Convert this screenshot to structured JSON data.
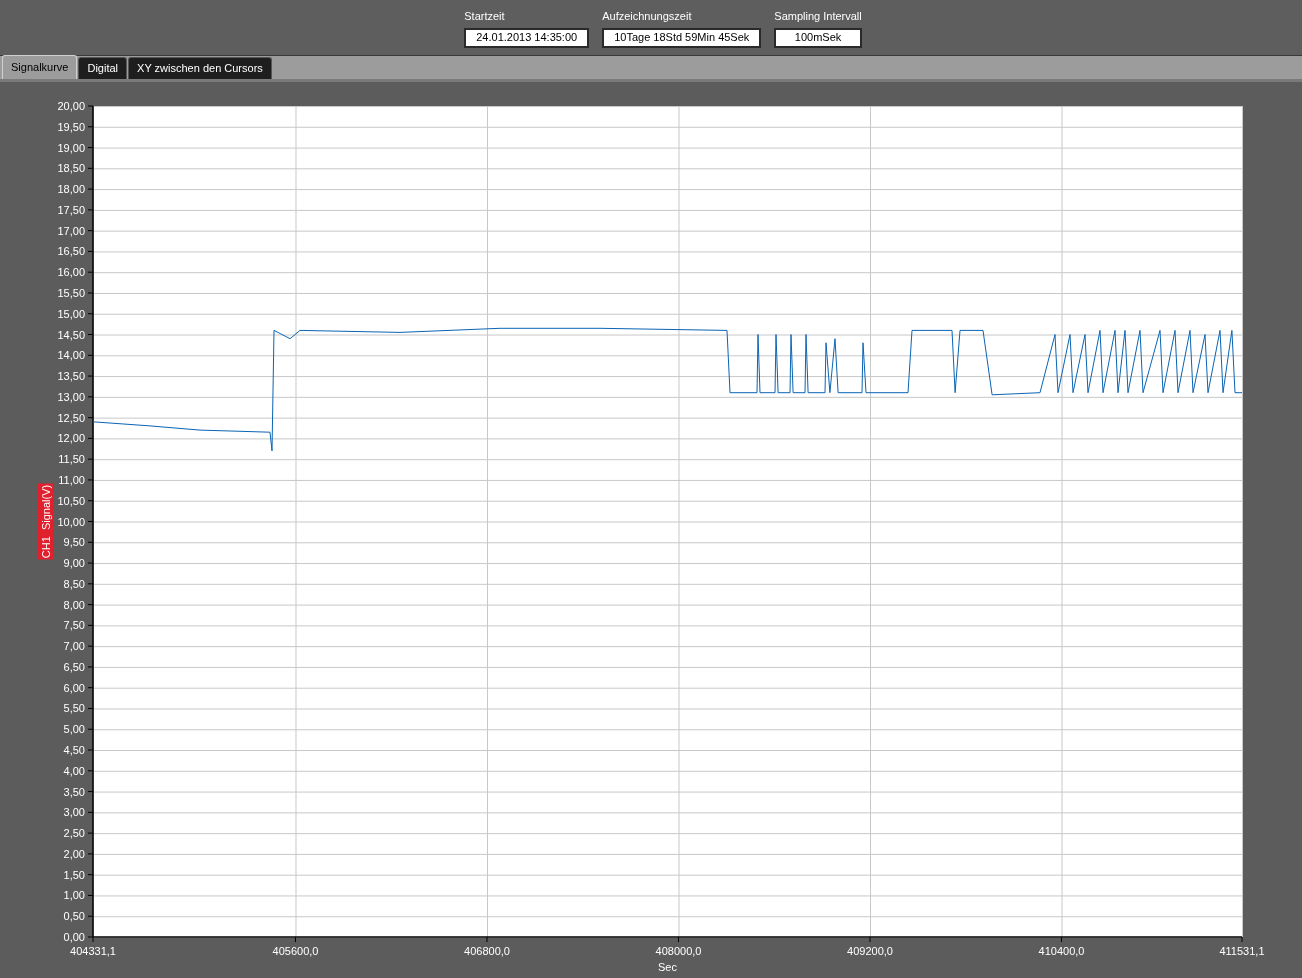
{
  "header_fields": [
    {
      "label": "Startzeit",
      "value": "24.01.2013 14:35:00"
    },
    {
      "label": "Aufzeichnungszeit",
      "value": "10Tage 18Std 59Min 45Sek"
    },
    {
      "label": "Sampling Intervall",
      "value": "100mSek"
    }
  ],
  "tabs": [
    {
      "label": "Signalkurve",
      "selected": true
    },
    {
      "label": "Digital",
      "selected": false
    },
    {
      "label": "XY zwischen den Cursors",
      "selected": false
    }
  ],
  "chart": {
    "chart_data": {
      "type": "line",
      "xlabel": "Sec",
      "ylabel": "CH1  Signal(V)",
      "xlim": [
        404331.1,
        411531.1
      ],
      "ylim": [
        0,
        20
      ],
      "xticks": [
        {
          "value": 404331.1,
          "label": "404331,1"
        },
        {
          "value": 405600,
          "label": "405600,0"
        },
        {
          "value": 406800,
          "label": "406800,0"
        },
        {
          "value": 408000,
          "label": "408000,0"
        },
        {
          "value": 409200,
          "label": "409200,0"
        },
        {
          "value": 410400,
          "label": "410400,0"
        },
        {
          "value": 411531.1,
          "label": "411531,1"
        }
      ],
      "yticks": [
        {
          "value": 0,
          "label": "0,00"
        },
        {
          "value": 0.5,
          "label": "0,50"
        },
        {
          "value": 1,
          "label": "1,00"
        },
        {
          "value": 1.5,
          "label": "1,50"
        },
        {
          "value": 2,
          "label": "2,00"
        },
        {
          "value": 2.5,
          "label": "2,50"
        },
        {
          "value": 3,
          "label": "3,00"
        },
        {
          "value": 3.5,
          "label": "3,50"
        },
        {
          "value": 4,
          "label": "4,00"
        },
        {
          "value": 4.5,
          "label": "4,50"
        },
        {
          "value": 5,
          "label": "5,00"
        },
        {
          "value": 5.5,
          "label": "5,50"
        },
        {
          "value": 6,
          "label": "6,00"
        },
        {
          "value": 6.5,
          "label": "6,50"
        },
        {
          "value": 7,
          "label": "7,00"
        },
        {
          "value": 7.5,
          "label": "7,50"
        },
        {
          "value": 8,
          "label": "8,00"
        },
        {
          "value": 8.5,
          "label": "8,50"
        },
        {
          "value": 9,
          "label": "9,00"
        },
        {
          "value": 9.5,
          "label": "9,50"
        },
        {
          "value": 10,
          "label": "10,00"
        },
        {
          "value": 10.5,
          "label": "10,50"
        },
        {
          "value": 11,
          "label": "11,00"
        },
        {
          "value": 11.5,
          "label": "11,50"
        },
        {
          "value": 12,
          "label": "12,00"
        },
        {
          "value": 12.5,
          "label": "12,50"
        },
        {
          "value": 13,
          "label": "13,00"
        },
        {
          "value": 13.5,
          "label": "13,50"
        },
        {
          "value": 14,
          "label": "14,00"
        },
        {
          "value": 14.5,
          "label": "14,50"
        },
        {
          "value": 15,
          "label": "15,00"
        },
        {
          "value": 15.5,
          "label": "15,50"
        },
        {
          "value": 16,
          "label": "16,00"
        },
        {
          "value": 16.5,
          "label": "16,50"
        },
        {
          "value": 17,
          "label": "17,00"
        },
        {
          "value": 17.5,
          "label": "17,50"
        },
        {
          "value": 18,
          "label": "18,00"
        },
        {
          "value": 18.5,
          "label": "18,50"
        },
        {
          "value": 19,
          "label": "19,00"
        },
        {
          "value": 19.5,
          "label": "19,50"
        },
        {
          "value": 20,
          "label": "20,00"
        }
      ],
      "grid": true,
      "x": [
        404331.1,
        404688,
        405002,
        405440,
        405453,
        405465,
        405566,
        405628,
        406255,
        406882,
        407508,
        408304,
        408323,
        408492,
        408498,
        408511,
        408605,
        408611,
        408624,
        408699,
        408705,
        408718,
        408793,
        408799,
        408812,
        408918,
        408924,
        408949,
        408981,
        409000,
        409150,
        409156,
        409175,
        409438,
        409463,
        409714,
        409733,
        409764,
        409908,
        409965,
        410265,
        410359,
        410378,
        410453,
        410472,
        410547,
        410566,
        410641,
        410660,
        410735,
        410754,
        410798,
        410817,
        410892,
        410911,
        411017,
        411036,
        411111,
        411130,
        411205,
        411224,
        411299,
        411318,
        411393,
        411412,
        411468,
        411487,
        411531
      ],
      "series": [
        {
          "color": "#0a64b4",
          "values": [
            12.4,
            12.3,
            12.2,
            12.15,
            11.7,
            14.6,
            14.4,
            14.6,
            14.55,
            14.65,
            14.65,
            14.6,
            13.1,
            13.1,
            14.5,
            13.1,
            13.1,
            14.5,
            13.1,
            13.1,
            14.5,
            13.1,
            13.1,
            14.5,
            13.1,
            13.1,
            14.3,
            13.1,
            14.4,
            13.1,
            13.1,
            14.3,
            13.1,
            13.1,
            14.6,
            14.6,
            13.1,
            14.6,
            14.6,
            13.05,
            13.1,
            14.5,
            13.1,
            14.5,
            13.1,
            14.5,
            13.1,
            14.6,
            13.1,
            14.6,
            13.1,
            14.6,
            13.1,
            14.6,
            13.1,
            14.6,
            13.1,
            14.6,
            13.1,
            14.6,
            13.1,
            14.5,
            13.1,
            14.6,
            13.1,
            14.6,
            13.1,
            13.1
          ]
        }
      ]
    }
  }
}
